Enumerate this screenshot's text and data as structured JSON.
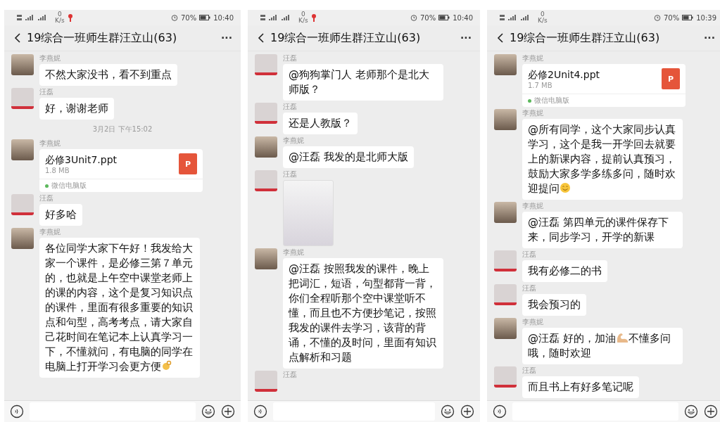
{
  "screens": [
    {
      "status": {
        "speed_value": "0",
        "speed_unit": "K/s",
        "notification": true,
        "battery": "70%",
        "time": "10:40"
      },
      "title": "19综合一班师生群汪立山(63)",
      "more": "···",
      "messages": [
        {
          "kind": "text",
          "sender": "李燕妮",
          "avatar": {
            "kind": "photo"
          },
          "segments": [
            {
              "kind": "text",
              "text": "不然大家没书，看不到重点"
            }
          ]
        },
        {
          "kind": "text",
          "sender": "汪磊",
          "avatar": {
            "kind": "poster"
          },
          "segments": [
            {
              "kind": "text",
              "text": "好，谢谢老师"
            }
          ]
        },
        {
          "kind": "time",
          "text": "3月2日 下午15:02"
        },
        {
          "kind": "file",
          "sender": "李燕妮",
          "avatar": {
            "kind": "photo"
          },
          "file": "必修3Unit7.ppt",
          "size": "1.8 MB",
          "badge": "P",
          "source": "微信电脑版"
        },
        {
          "kind": "text",
          "sender": "汪磊",
          "avatar": {
            "kind": "poster"
          },
          "segments": [
            {
              "kind": "text",
              "text": "好多哈"
            }
          ]
        },
        {
          "kind": "text",
          "sender": "李燕妮",
          "avatar": {
            "kind": "photo"
          },
          "segments": [
            {
              "kind": "text",
              "text": "各位同学大家下午好！我发给大家一个课件，是必修三第７单元的，也就是上午空中课堂老师上的课的内容，这个是复习知识点的课件，里面有很多重要的知识点和句型，高考考点，请大家自己花时间在笔记本上认真学习一下，不懂就问，有电脑的同学在电脑上打开学习会更方便"
            },
            {
              "kind": "ok-hand"
            }
          ]
        }
      ]
    },
    {
      "status": {
        "speed_value": "0",
        "speed_unit": "K/s",
        "notification": true,
        "battery": "70%",
        "time": "10:40"
      },
      "title": "19综合一班师生群汪立山(63)",
      "more": "···",
      "messages": [
        {
          "kind": "text",
          "sender": "汪磊",
          "avatar": {
            "kind": "poster"
          },
          "segments": [
            {
              "kind": "text",
              "text": "@狗狗掌门人  老师那个是北大师版？"
            }
          ]
        },
        {
          "kind": "text",
          "sender": "汪磊",
          "avatar": {
            "kind": "poster"
          },
          "segments": [
            {
              "kind": "text",
              "text": "还是人教版？"
            }
          ]
        },
        {
          "kind": "text",
          "sender": "李燕妮",
          "avatar": {
            "kind": "photo"
          },
          "segments": [
            {
              "kind": "text",
              "text": "@汪磊  我发的是北师大版"
            }
          ]
        },
        {
          "kind": "image",
          "sender": "汪磊",
          "avatar": {
            "kind": "poster"
          }
        },
        {
          "kind": "text",
          "sender": "李燕妮",
          "avatar": {
            "kind": "photo"
          },
          "segments": [
            {
              "kind": "text",
              "text": "@汪磊  按照我发的课件，晚上把词汇，短语，句型都背一背，你们全程听那个空中课堂听不懂，而且也不方便抄笔记，按照我发的课件去学习，该背的背诵，不懂的及时问，里面有知识点解析和习题"
            }
          ]
        },
        {
          "kind": "name",
          "sender": "汪磊",
          "avatar": {
            "kind": "poster"
          }
        }
      ]
    },
    {
      "status": {
        "speed_value": "0",
        "speed_unit": "K/s",
        "notification": false,
        "battery": "70%",
        "time": "10:39"
      },
      "title": "19综合一班师生群汪立山(63)",
      "more": "···",
      "messages": [
        {
          "kind": "file",
          "sender": "李燕妮",
          "avatar": {
            "kind": "photo"
          },
          "file": "必修2Unit4.ppt",
          "size": "1.7 MB",
          "badge": "P",
          "source": "微信电脑版"
        },
        {
          "kind": "text",
          "sender": "李燕妮",
          "avatar": {
            "kind": "photo"
          },
          "segments": [
            {
              "kind": "text",
              "text": "@所有同学，这个大家同步认真学习，这个是我一开学回去就要上的新课内容，提前认真预习，鼓励大家多学多练多问，随时欢迎提问"
            },
            {
              "kind": "smile"
            }
          ]
        },
        {
          "kind": "text",
          "sender": "李燕妮",
          "avatar": {
            "kind": "photo"
          },
          "segments": [
            {
              "kind": "text",
              "text": "@汪磊  第四单元的课件保存下来，同步学习，开学的新课"
            }
          ]
        },
        {
          "kind": "text",
          "sender": "汪磊",
          "avatar": {
            "kind": "poster"
          },
          "segments": [
            {
              "kind": "text",
              "text": "我有必修二的书"
            }
          ]
        },
        {
          "kind": "text",
          "sender": "汪磊",
          "avatar": {
            "kind": "poster"
          },
          "segments": [
            {
              "kind": "text",
              "text": "我会预习的"
            }
          ]
        },
        {
          "kind": "text",
          "sender": "李燕妮",
          "avatar": {
            "kind": "photo"
          },
          "segments": [
            {
              "kind": "text",
              "text": "@汪磊  好的，加油"
            },
            {
              "kind": "muscle"
            },
            {
              "kind": "text",
              "text": "不懂多问哦，随时欢迎"
            }
          ]
        },
        {
          "kind": "text",
          "sender": "汪磊",
          "avatar": {
            "kind": "poster"
          },
          "segments": [
            {
              "kind": "text",
              "text": "而且书上有好多笔记呢"
            }
          ]
        }
      ]
    }
  ]
}
